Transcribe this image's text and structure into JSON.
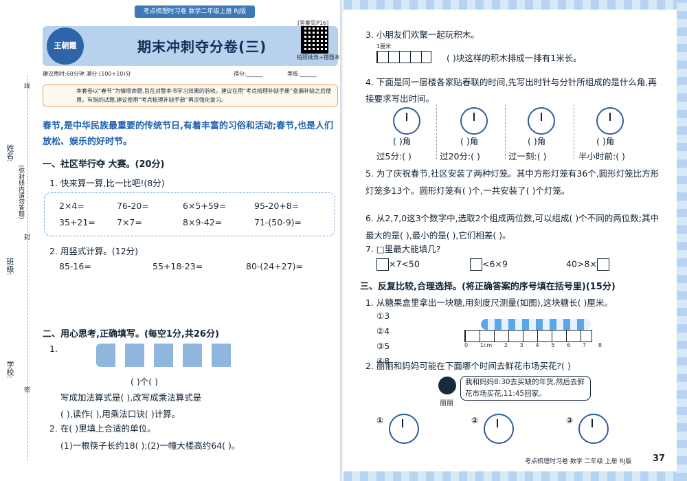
{
  "header": {
    "top_bar": "考点梳理时习卷  数学二年级上册  RJ版",
    "answer_ref": "[答案见P16]",
    "title": "期末冲刺夺分卷(三)",
    "logo_text": "王朝霞",
    "qr_caption": "拍照批改+错题本",
    "suggest": "建议用时:60分钟  满分:(100+10)分",
    "score": "得分:______",
    "grade": "等级:______"
  },
  "note": "本套卷以“春节”为情境命题,旨在对整本书学习效果的验收。建议在用“考点梳理补缺手册”查漏补缺之后使用。有错的试题,建议使用“考点梳理补缺手册”再次强化复习。",
  "intro": "春节,是中华民族最重要的传统节日,有着丰富的习俗和活动;春节,也是人们放松、娱乐的好时节。",
  "margin": {
    "name": "姓名:",
    "class": "班级:",
    "school": "学校:",
    "inside": "(弥封线内请勿答题)",
    "m1": "线",
    "m2": "封",
    "m3": "密"
  },
  "section1": {
    "title": "一、社区举行夺  大赛。(20分)",
    "q1": "1. 快来算一算,比一比吧!(8分)",
    "calc": [
      "2×4=",
      "76-20=",
      "6×5+59=",
      "95-20+8=",
      "35+21=",
      "7×7=",
      "8×9-42=",
      "71-(50-9)="
    ],
    "q2": "2. 用竖式计算。(12分)",
    "vert": [
      "85-16=",
      "55+18-23=",
      "80-(24+27)="
    ]
  },
  "section2": {
    "title": "二、用心思考,正确填写。(每空1分,共26分)",
    "q1": "1.",
    "groups": "(    )个(    )",
    "l1": "写成加法算式是(                    ),改写成乘法算式是",
    "l2": "(          ),读作(          ),用乘法口诀(          )计算。",
    "q2": "2. 在(    )里填上合适的单位。",
    "q2a": "(1)一根筷子长约18(    );(2)一幢大楼高约64(    )。"
  },
  "right": {
    "q3": "3. 小朋友们欢聚一起玩积木。",
    "q3_unit": "1厘米",
    "q3_text": "(        )块这样的积木排成一排有1米长。",
    "q4": "4. 下面是同一层楼各家贴春联的时间,先写出时针与分针所组成的是什么角,再接要求写出时间。",
    "clock_angle": [
      "(  )角",
      "(  )角",
      "(  )角",
      "(  )角"
    ],
    "clock_q": [
      "过5分:(  )",
      "过20分:(  )",
      "过一刻:(  )",
      "半小时前:(  )"
    ],
    "q5": "5. 为了庆祝春节,社区安装了两种灯笼。其中方形灯笼有36个,圆形灯笼比方形灯笼多13个。圆形灯笼有(      )个,一共安装了(      )个灯笼。",
    "q6": "6. 从2,7,0这3个数字中,选取2个组成两位数,可以组成(      )个不同的两位数;其中最大的是(      ),最小的是(      ),它们相差(      )。",
    "q7": "7. □里最大能填几?",
    "q7_items": [
      "×7<50",
      "<6×9",
      "40>8×"
    ],
    "section3": "三、反复比较,合理选择。(将正确答案的序号填在括号里)(15分)",
    "s3q1": "1. 从糖果盒里拿出一块糖,用刻度尺测量(如图),这块糖长(      )厘米。",
    "opts": [
      "①3",
      "②4",
      "③5",
      "④8"
    ],
    "ruler_labels": [
      "0",
      "1cm",
      "2",
      "3",
      "4",
      "5",
      "6",
      "7",
      "8"
    ],
    "s3q2": "2. 丽丽和妈妈可能在下面哪个时间去鲜花市场买花?(    )",
    "speech": "我和妈妈8:30去买缺的年货,然后去鲜花市场买花,11:45回家。",
    "girl": "丽丽",
    "clock_opts": [
      "①",
      "②",
      "③"
    ],
    "footer": "考点梳理时习卷  数学  二年级  上册  RJ版",
    "page": "37"
  }
}
